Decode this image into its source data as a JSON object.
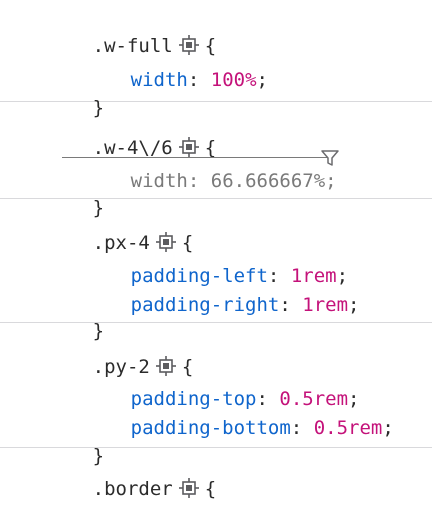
{
  "rules": [
    {
      "selector": ".w-full",
      "open_brace": "{",
      "close_brace": "}",
      "declarations": [
        {
          "property": "width",
          "colon": ":",
          "value": "100%",
          "semicolon": ";"
        }
      ]
    },
    {
      "selector": ".w-4\\/6",
      "open_brace": "{",
      "close_brace": "}",
      "declarations": [
        {
          "property": "width",
          "colon": ":",
          "value": "66.666667%",
          "semicolon": ";",
          "overridden": true
        }
      ]
    },
    {
      "selector": ".px-4",
      "open_brace": "{",
      "close_brace": "}",
      "declarations": [
        {
          "property": "padding-left",
          "colon": ":",
          "value": "1rem",
          "semicolon": ";"
        },
        {
          "property": "padding-right",
          "colon": ":",
          "value": "1rem",
          "semicolon": ";"
        }
      ]
    },
    {
      "selector": ".py-2",
      "open_brace": "{",
      "close_brace": "}",
      "declarations": [
        {
          "property": "padding-top",
          "colon": ":",
          "value": "0.5rem",
          "semicolon": ";"
        },
        {
          "property": "padding-bottom",
          "colon": ":",
          "value": "0.5rem",
          "semicolon": ";"
        }
      ]
    },
    {
      "selector": ".border",
      "open_brace": "{"
    }
  ],
  "icons": {
    "grid_toggle": "grid-highlighter-icon",
    "filter": "filter-icon"
  },
  "colors": {
    "property": "#0f65cc",
    "value": "#c4127a",
    "overridden": "#7a7a7a",
    "separator": "#d9d9dc"
  }
}
